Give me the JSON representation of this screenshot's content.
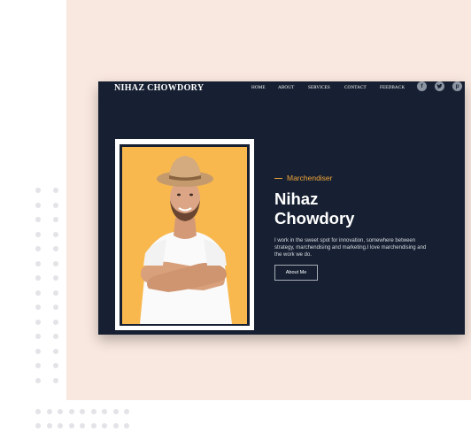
{
  "header": {
    "brand": "NIHAZ CHOWDORY",
    "nav": [
      "HOME",
      "ABOUT",
      "SERVICES",
      "CONTACT",
      "FEEDBACK"
    ],
    "social_icons": [
      "facebook-icon",
      "twitter-icon",
      "pinterest-icon"
    ]
  },
  "hero": {
    "role": "Marchendiser",
    "name_line1": "Nihaz",
    "name_line2": "Chowdory",
    "description": "I work in the sweet spot for innovation, somewhere between strategy, marchendising and marketing.I love marchendising and the work we do.",
    "button_label": "About Me"
  },
  "colors": {
    "background_panel": "#f9e8df",
    "mockup_bg": "#162032",
    "accent": "#f0a43a",
    "photo_bg": "#f8b84e"
  }
}
